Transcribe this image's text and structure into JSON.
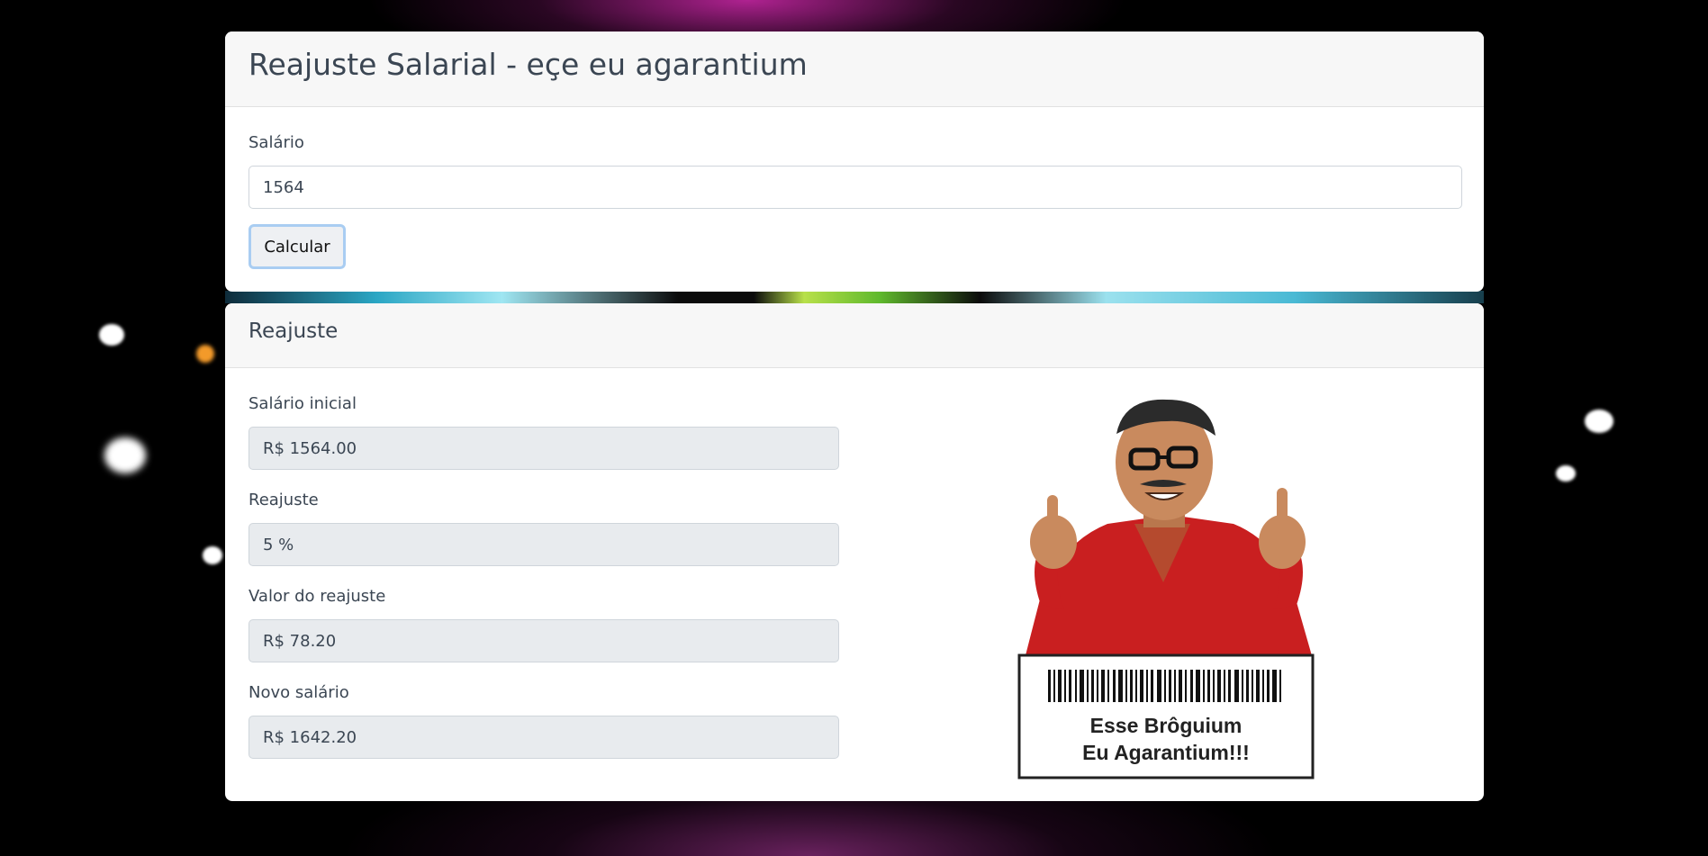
{
  "form": {
    "title": "Reajuste Salarial - eçe eu agarantium",
    "salary_label": "Salário",
    "salary_value": "1564",
    "calculate_button": "Calcular"
  },
  "result": {
    "title": "Reajuste",
    "fields": [
      {
        "label": "Salário inicial",
        "value": "R$ 1564.00"
      },
      {
        "label": "Reajuste",
        "value": "5 %"
      },
      {
        "label": "Valor do reajuste",
        "value": "R$ 78.20"
      },
      {
        "label": "Novo salário",
        "value": "R$ 1642.20"
      }
    ],
    "image": {
      "subject": "man-giving-thumbs-up",
      "caption_line1": "Esse Brôguium",
      "caption_line2": "Eu Agarantium!!!"
    }
  },
  "colors": {
    "header_bg": "#f7f7f7",
    "readonly_bg": "#e8ebee",
    "button_focus_ring": "#a9cdf2",
    "background_glow": "#ce28aa"
  }
}
